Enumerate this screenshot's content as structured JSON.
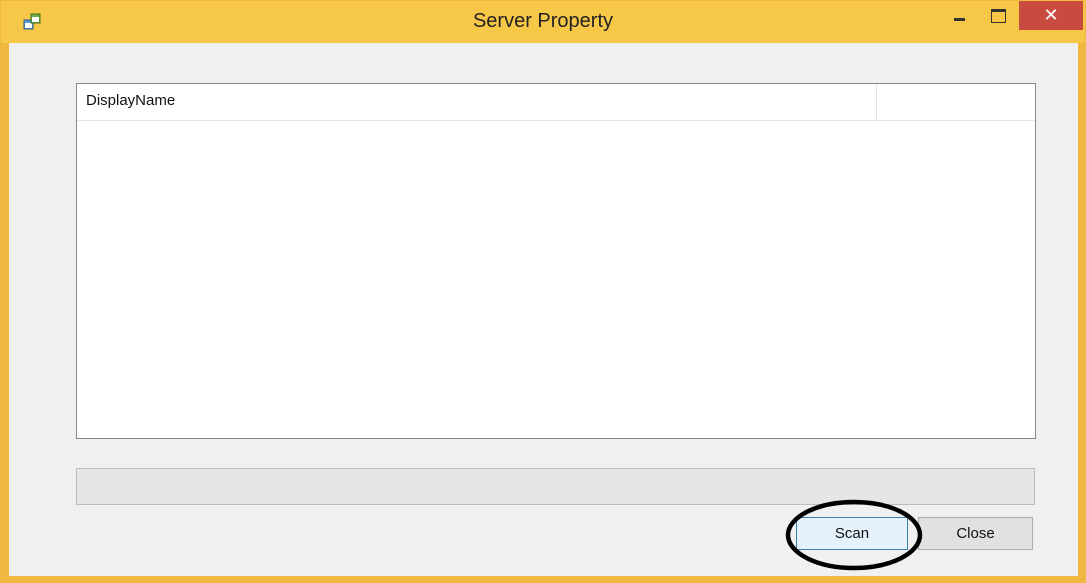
{
  "window": {
    "title": "Server Property",
    "title_bar_color": "#f7c748",
    "close_button_color": "#c94b40",
    "controls": {
      "minimize_icon": "minimize-icon",
      "maximize_icon": "maximize-icon",
      "close_glyph": "✕"
    },
    "app_icon": "app-window-icon"
  },
  "list": {
    "columns": [
      "DisplayName"
    ],
    "rows": []
  },
  "progress": {
    "value": 0
  },
  "buttons": {
    "scan_label": "Scan",
    "close_label": "Close"
  },
  "annotation": {
    "type": "ellipse-highlight",
    "target": "scan-button",
    "color": "#000000"
  }
}
